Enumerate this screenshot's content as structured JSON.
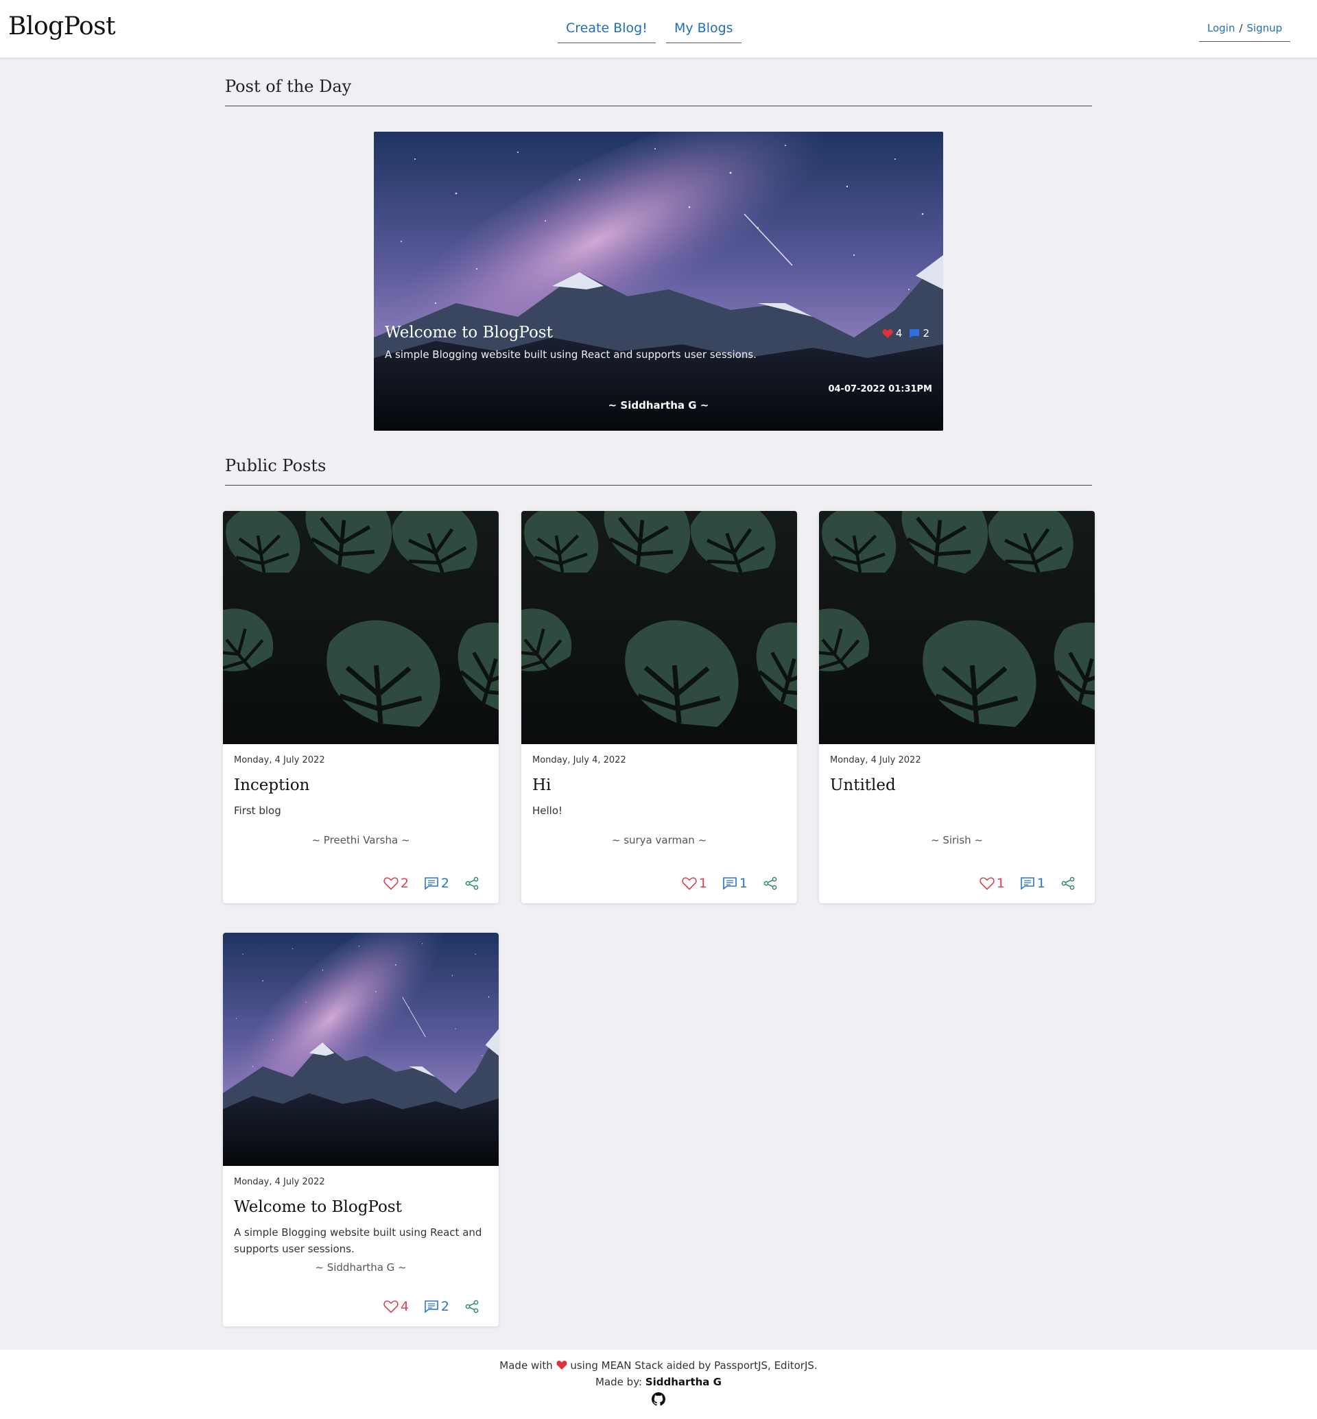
{
  "header": {
    "brand": "BlogPost",
    "nav": {
      "create": "Create Blog!",
      "my_blogs": "My Blogs"
    },
    "auth": {
      "login": "Login",
      "separator": "/",
      "signup": "Signup"
    }
  },
  "post_of_day": {
    "heading": "Post of the Day",
    "title": "Welcome to BlogPost",
    "description": "A simple Blogging website built using React and supports user sessions.",
    "likes": "4",
    "comments": "2",
    "datetime": "04-07-2022 01:31PM",
    "author": "~ Siddhartha G ~",
    "image_icon": "mountain-night-sky"
  },
  "public_posts": {
    "heading": "Public Posts",
    "items": [
      {
        "date": "Monday, 4 July 2022",
        "title": "Inception",
        "description": "First blog",
        "author": "~ Preethi Varsha ~",
        "likes": "2",
        "comments": "2",
        "image": "monstera-leaves"
      },
      {
        "date": "Monday, July 4, 2022",
        "title": "Hi",
        "description": "Hello!",
        "author": "~ surya varman ~",
        "likes": "1",
        "comments": "1",
        "image": "monstera-leaves"
      },
      {
        "date": "Monday, 4 July 2022",
        "title": "Untitled",
        "description": "",
        "author": "~ Sirish ~",
        "likes": "1",
        "comments": "1",
        "image": "monstera-leaves"
      },
      {
        "date": "Monday, 4 July 2022",
        "title": "Welcome to BlogPost",
        "description": "A simple Blogging website built using React and supports user sessions.",
        "author": "~ Siddhartha G ~",
        "likes": "4",
        "comments": "2",
        "image": "mountain-night-sky"
      }
    ]
  },
  "footer": {
    "made_with": "Made with",
    "made_with_rest": "using MEAN Stack aided by PassportJS, EditorJS.",
    "made_by_label": "Made by:",
    "made_by_name": "Siddhartha G"
  },
  "colors": {
    "like": "#d64550",
    "comment": "#2b74c4",
    "share": "#2e8a6a",
    "link": "#1f6fb8",
    "background": "#f0f0f4"
  }
}
